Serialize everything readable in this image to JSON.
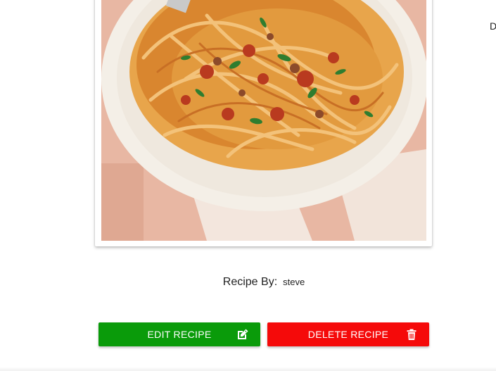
{
  "recipe": {
    "image_alt": "spaghetti-bolognese-photo",
    "by_label": "Recipe By:",
    "by_value": "steve"
  },
  "edge_text": "D",
  "actions": {
    "edit_label": "EDIT RECIPE",
    "edit_icon": "edit-icon",
    "edit_color": "#0a9b0a",
    "delete_label": "DELETE RECIPE",
    "delete_icon": "trash-icon",
    "delete_color": "#f50a0a"
  }
}
